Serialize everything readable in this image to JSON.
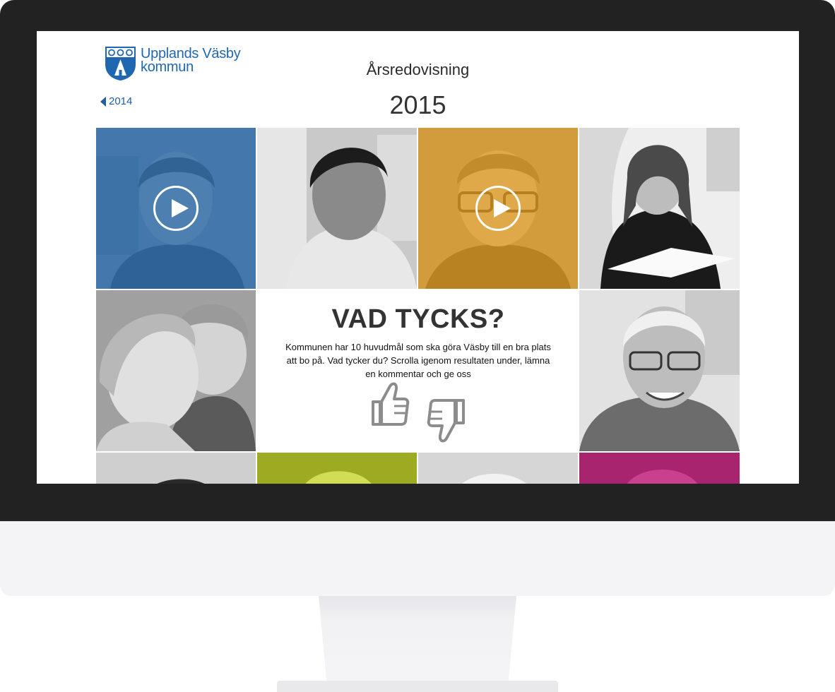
{
  "header": {
    "logo_line1": "Upplands Väsby",
    "logo_line2": "kommun",
    "title": "Årsredovisning",
    "year": "2015",
    "prev_year": "2014"
  },
  "feedback": {
    "heading": "VAD TYCKS?",
    "text": "Kommunen har 10 huvudmål som ska göra Väsby till en bra plats att bo på. Vad tycker du? Scrolla igenom resultaten under, lämna en kommentar och ge oss"
  },
  "colors": {
    "brand_blue": "#1f67b1",
    "tile_blue": "#2f6fb0",
    "tile_orange": "#e8a020",
    "tile_green": "#a4b21c",
    "tile_magenta": "#b42b7e",
    "bezel": "#222222"
  },
  "icons": [
    "play-icon",
    "thumbs-up-icon",
    "thumbs-down-icon",
    "left-triangle-icon",
    "municipal-crest"
  ]
}
